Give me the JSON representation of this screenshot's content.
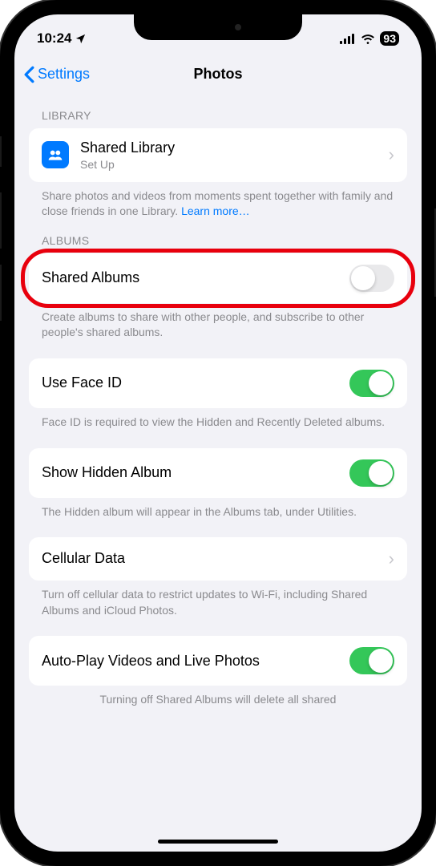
{
  "status": {
    "time": "10:24",
    "battery": "93"
  },
  "nav": {
    "back": "Settings",
    "title": "Photos"
  },
  "library": {
    "header": "LIBRARY",
    "shared_library": {
      "title": "Shared Library",
      "sub": "Set Up"
    },
    "footer": "Share photos and videos from moments spent together with family and close friends in one Library.",
    "learn_more": "Learn more…"
  },
  "albums": {
    "header": "ALBUMS",
    "shared_albums": {
      "title": "Shared Albums",
      "on": false
    },
    "footer": "Create albums to share with other people, and subscribe to other people's shared albums."
  },
  "faceid": {
    "title": "Use Face ID",
    "on": true,
    "footer": "Face ID is required to view the Hidden and Recently Deleted albums."
  },
  "hidden": {
    "title": "Show Hidden Album",
    "on": true,
    "footer": "The Hidden album will appear in the Albums tab, under Utilities."
  },
  "cellular": {
    "title": "Cellular Data",
    "footer": "Turn off cellular data to restrict updates to Wi-Fi, including Shared Albums and iCloud Photos."
  },
  "autoplay": {
    "title": "Auto-Play Videos and Live Photos",
    "on": true,
    "footer": "Turning off Shared Albums will delete all shared"
  }
}
